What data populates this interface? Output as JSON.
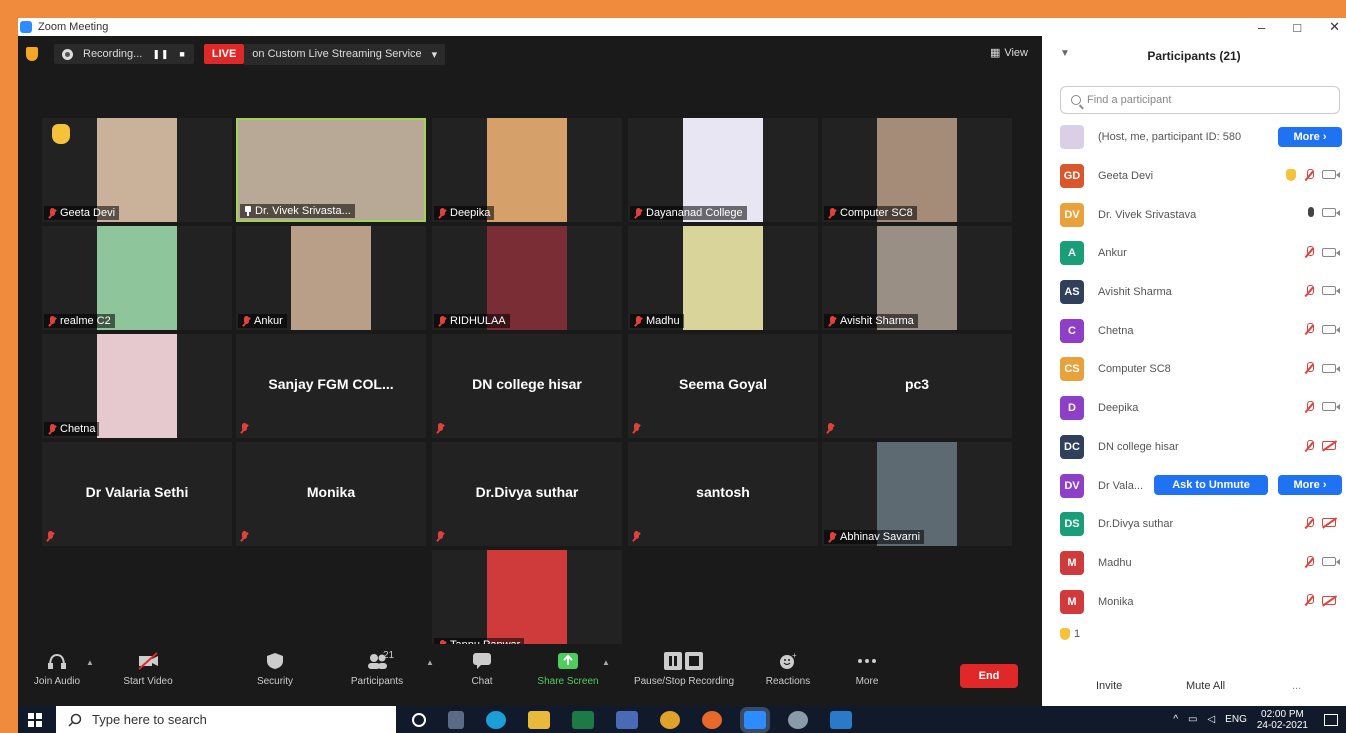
{
  "window": {
    "title": "Zoom Meeting"
  },
  "status_bar": {
    "recording_label": "Recording...",
    "live_label": "LIVE",
    "stream_label": "on Custom Live Streaming Service",
    "view_label": "View"
  },
  "tiles": [
    {
      "name": "Geeta Devi",
      "photo": "#c9b19a",
      "raised": true
    },
    {
      "name": "Dr. Vivek Srivasta...",
      "photo": "#b7a995",
      "active": true
    },
    {
      "name": "Deepika",
      "photo": "#d6a06a"
    },
    {
      "name": "Dayananad College",
      "photo": "#e8e6f3"
    },
    {
      "name": "Computer SC8",
      "photo": "#a58c78"
    },
    {
      "name": "realme C2",
      "photo": "#8ec59a"
    },
    {
      "name": "Ankur",
      "photo": "#b99f88"
    },
    {
      "name": "RIDHULAA",
      "photo": "#7a2d34"
    },
    {
      "name": "Madhu",
      "photo": "#d9d59a"
    },
    {
      "name": "Avishit Sharma",
      "photo": "#9a8f84"
    },
    {
      "name": "Chetna",
      "photo": "#e6c8cf"
    },
    {
      "name": "Sanjay  FGM  COL..."
    },
    {
      "name": "DN college hisar"
    },
    {
      "name": "Seema Goyal"
    },
    {
      "name": "pc3"
    },
    {
      "name": "Dr Valaria Sethi"
    },
    {
      "name": "Monika"
    },
    {
      "name": "Dr.Divya suthar"
    },
    {
      "name": "santosh"
    },
    {
      "name": "Abhinav Savarni",
      "photo": "#5e6a72"
    },
    {
      "name": "Tannu Panwar",
      "photo": "#cf3a3a"
    }
  ],
  "toolbar": {
    "join_audio": "Join Audio",
    "start_video": "Start Video",
    "security": "Security",
    "participants": "Participants",
    "participants_count": "21",
    "chat": "Chat",
    "share_screen": "Share Screen",
    "pause_stop_recording": "Pause/Stop Recording",
    "reactions": "Reactions",
    "more": "More",
    "end": "End"
  },
  "panel": {
    "title": "Participants (21)",
    "search_placeholder": "Find a participant",
    "host_text": "(Host, me, participant ID: 580",
    "more_label": "More",
    "ask_unmute_label": "Ask to Unmute",
    "raised_count": "1",
    "invite_label": "Invite",
    "mute_all_label": "Mute All",
    "more_dots": "...",
    "participants": [
      {
        "initials": "GD",
        "name": "Geeta Devi",
        "color": "#d9572a",
        "hand": true,
        "mic": "muted",
        "cam": "on"
      },
      {
        "initials": "DV",
        "name": "Dr. Vivek Srivastava",
        "color": "#e9a13b",
        "mic": "active",
        "cam": "on"
      },
      {
        "initials": "A",
        "name": "Ankur",
        "color": "#1a9e78",
        "mic": "muted",
        "cam": "on"
      },
      {
        "initials": "AS",
        "name": "Avishit Sharma",
        "color": "#2f3f5c",
        "mic": "muted",
        "cam": "on"
      },
      {
        "initials": "C",
        "name": "Chetna",
        "color": "#8f3fc7",
        "mic": "muted",
        "cam": "on"
      },
      {
        "initials": "CS",
        "name": "Computer SC8",
        "color": "#e9a13b",
        "mic": "muted",
        "cam": "on"
      },
      {
        "initials": "D",
        "name": "Deepika",
        "color": "#8f3fc7",
        "mic": "muted",
        "cam": "on"
      },
      {
        "initials": "DC",
        "name": "DN college hisar",
        "color": "#2f3f5c",
        "mic": "muted",
        "cam": "off"
      },
      {
        "initials": "DV",
        "name": "Dr Vala...",
        "color": "#8f3fc7",
        "mic": "muted",
        "cam": "off",
        "hover": true
      },
      {
        "initials": "DS",
        "name": "Dr.Divya suthar",
        "color": "#1a9e78",
        "mic": "muted",
        "cam": "off"
      },
      {
        "initials": "M",
        "name": "Madhu",
        "color": "#d03a3a",
        "mic": "muted",
        "cam": "on"
      },
      {
        "initials": "M",
        "name": "Monika",
        "color": "#d03a3a",
        "mic": "muted",
        "cam": "off"
      }
    ]
  },
  "taskbar": {
    "search_placeholder": "Type here to search",
    "lang": "ENG",
    "time": "02:00 PM",
    "date": "24-02-2021"
  },
  "colors": {
    "accent": "#2d8cff",
    "live": "#e02828",
    "end": "#e02828",
    "frame": "#f08a3c"
  }
}
